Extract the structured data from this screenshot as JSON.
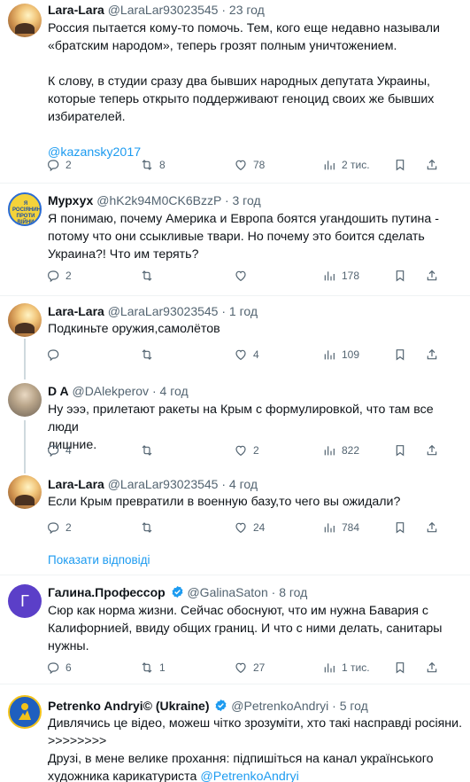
{
  "tweets": [
    {
      "name": "Lara-Lara",
      "handle": "@LaraLar93023545",
      "time": "23 год",
      "text_lines": [
        "Россия пытается кому-то помочь. Тем, кого еще недавно называли",
        "«братским народом», теперь грозят полным уничтожением.",
        "",
        "К слову, в студии сразу два бывших народных депутата Украины,",
        "которые теперь открыто поддерживают геноцид своих же бывших",
        "избирателей.",
        "",
        "@kazansky2017"
      ],
      "replies": "2",
      "retweets": "8",
      "likes": "78",
      "views": "2 тис."
    },
    {
      "name": "Мурхух",
      "handle": "@hK2k94M0CK6BzzP",
      "time": "3 год",
      "avatar_text": "Я РОСІЯНИН ПРОТИ ВІЙНИ",
      "text_lines": [
        "Я понимаю, почему Америка и Европа боятся угандошить путина -",
        "потому что они ссыкливые твари. Но почему это боится сделать",
        "Украина?! Что им терять?"
      ],
      "replies": "2",
      "retweets": "",
      "likes": "",
      "views": "178"
    },
    {
      "name": "Lara-Lara",
      "handle": "@LaraLar93023545",
      "time": "1 год",
      "text_lines": [
        "Подкиньте оружия,самолётов"
      ],
      "replies": "",
      "retweets": "",
      "likes": "4",
      "views": "109"
    },
    {
      "name": "D A",
      "handle": "@DAlekperov",
      "time": "4 год",
      "text_lines": [
        "Ну эээ, прилетают ракеты на Крым с формулировкой, что там все люди",
        "лишние."
      ],
      "replies": "4",
      "retweets": "",
      "likes": "2",
      "views": "822"
    },
    {
      "name": "Lara-Lara",
      "handle": "@LaraLar93023545",
      "time": "4 год",
      "text_lines": [
        "Если Крым превратили в военную базу,то чего вы ожидали?"
      ],
      "replies": "2",
      "retweets": "",
      "likes": "24",
      "views": "784"
    },
    {
      "name": "Галина.Профессор",
      "handle": "@GalinaSaton",
      "time": "8 год",
      "avatar_letter": "Г",
      "text_lines": [
        "Сюр как норма жизни. Сейчас обоснуют, что им нужна Бавария с",
        "Калифорнией, ввиду общих границ. И что с ними делать, санитары",
        "нужны."
      ],
      "replies": "6",
      "retweets": "1",
      "likes": "27",
      "views": "1 тис."
    },
    {
      "name": "Petrenko Andryi© (Ukraine)",
      "handle": "@PetrenkoAndryi",
      "time": "5 год",
      "text_lines": [
        "Дивлячись це відео, можеш чітко зрозуміти, хто такі насправді росіяни.",
        ">>>>>>>>",
        "Друзі, в мене велике прохання: підпишіться на канал українського",
        "художника карикатуриста "
      ],
      "mention": "@PetrenkoAndryi"
    }
  ],
  "show_replies_label": "Показати відповіді",
  "dot": "·",
  "colors": {
    "accent": "#1d9bf0",
    "muted": "#536471",
    "text": "#0f1419",
    "divider": "#eff3f4"
  }
}
